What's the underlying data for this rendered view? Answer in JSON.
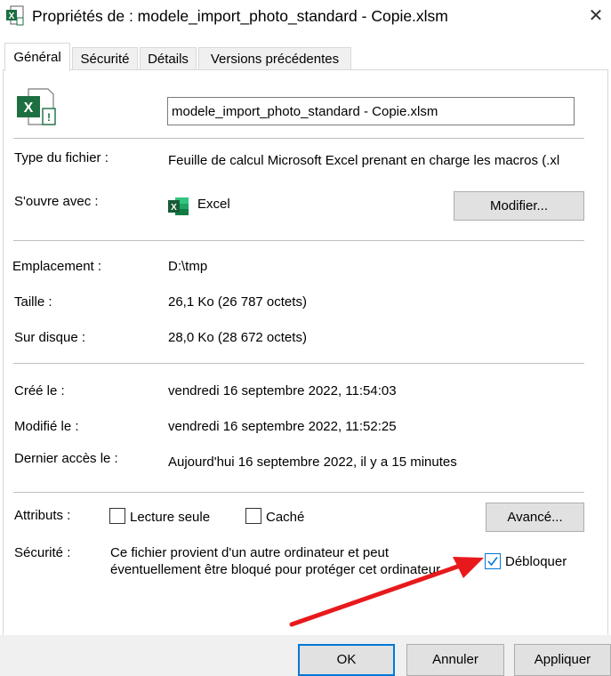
{
  "window": {
    "title": "Propriétés de : modele_import_photo_standard - Copie.xlsm",
    "close_glyph": "✕"
  },
  "tabs": [
    {
      "label": "Général",
      "active": true
    },
    {
      "label": "Sécurité"
    },
    {
      "label": "Détails"
    },
    {
      "label": "Versions précédentes"
    }
  ],
  "file": {
    "name": "modele_import_photo_standard - Copie.xlsm",
    "type_label": "Type du fichier :",
    "type_value": "Feuille de calcul Microsoft Excel prenant en charge les macros (.xl",
    "opens_with_label": "S'ouvre avec :",
    "opens_with_app": "Excel",
    "change_button": "Modifier..."
  },
  "location": {
    "location_label": "Emplacement :",
    "location_value": "D:\\tmp",
    "size_label": "Taille :",
    "size_value": "26,1 Ko (26 787 octets)",
    "disk_label": "Sur disque :",
    "disk_value": "28,0 Ko (28 672 octets)"
  },
  "dates": {
    "created_label": "Créé le :",
    "created_value": "vendredi 16 septembre 2022, 11:54:03",
    "modified_label": "Modifié le :",
    "modified_value": "vendredi 16 septembre 2022, 11:52:25",
    "accessed_label": "Dernier accès le :",
    "accessed_value": "Aujourd'hui 16 septembre 2022, il y a 15 minutes"
  },
  "attributes": {
    "label": "Attributs :",
    "readonly_label": "Lecture seule",
    "readonly_checked": false,
    "hidden_label": "Caché",
    "hidden_checked": false,
    "advanced_button": "Avancé..."
  },
  "security": {
    "label": "Sécurité :",
    "message_line1": "Ce fichier provient d'un autre ordinateur et peut",
    "message_line2": "éventuellement être bloqué pour protéger cet ordinateur.",
    "unblock_label": "Débloquer",
    "unblock_checked": true
  },
  "buttons": {
    "ok": "OK",
    "cancel": "Annuler",
    "apply": "Appliquer"
  },
  "colors": {
    "accent": "#0078d7",
    "excel_green": "#1d6f42",
    "arrow_red": "#e8191c"
  }
}
